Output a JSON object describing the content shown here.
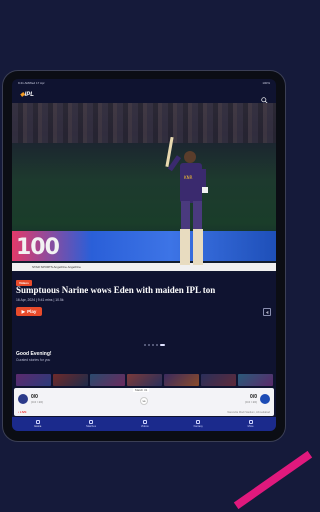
{
  "status_bar": {
    "time": "9:41 AM",
    "date": "Wed 17 Apr",
    "battery": "100%"
  },
  "header": {
    "logo": "IPL",
    "search_icon": "search-icon"
  },
  "hero": {
    "board_text": "100",
    "board_strip_text": "STAR SPORTS   AngelOne   AngelOne",
    "tag": "Videos",
    "headline": "Sumptuous Narine wows Eden with maiden IPL ton",
    "meta": "16 Apr, 2024 | 9:41 mins | 10.5k",
    "play_label": "Play"
  },
  "greeting": {
    "title": "Good Evening!",
    "subtitle": "Curated stories for you"
  },
  "thumbnails": [
    "",
    "",
    "",
    "",
    "",
    "",
    ""
  ],
  "match": {
    "label": "Match 31",
    "left_score": "0/0",
    "left_overs": "(0.0 / 20)",
    "right_score": "0/0",
    "right_overs": "(0.0 / 20)",
    "vs": "vs",
    "live": "• LIVE",
    "venue": "Narendra Modi Stadium, Ahmedabad",
    "left_color": "#2b3a8a",
    "right_color": "#1c4bb5"
  },
  "nav": [
    {
      "label": "Home",
      "icon": "home-icon"
    },
    {
      "label": "Matches",
      "icon": "matches-icon"
    },
    {
      "label": "Videos",
      "icon": "videos-icon"
    },
    {
      "label": "Fantasy",
      "icon": "fantasy-icon"
    },
    {
      "label": "More",
      "icon": "more-icon"
    }
  ],
  "colors": {
    "accent": "#e84b2b",
    "nav_bg": "#1b2a8c",
    "page_bg": "#151a3a"
  }
}
